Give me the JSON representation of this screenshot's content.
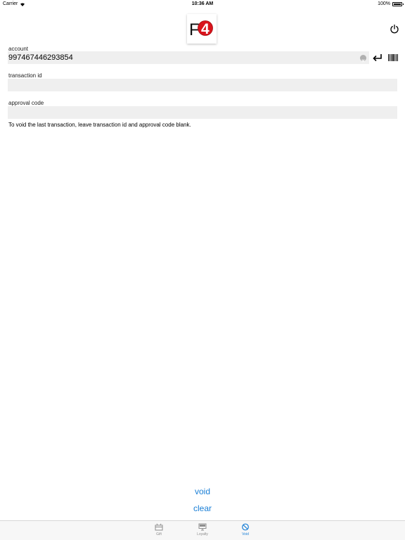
{
  "status_bar": {
    "carrier": "Carrier",
    "time": "10:36 AM",
    "battery": "100%",
    "battery_level": 1.0
  },
  "header": {
    "logo_text": "F4",
    "power_icon": "power-icon"
  },
  "form": {
    "account": {
      "label": "account",
      "value": "997467446293854"
    },
    "transaction_id": {
      "label": "transaction id",
      "value": ""
    },
    "approval_code": {
      "label": "approval code",
      "value": ""
    },
    "hint": "To void the last transaction, leave transaction id and approval code blank."
  },
  "actions": {
    "void_label": "void",
    "clear_label": "clear"
  },
  "tabs": [
    {
      "label": "Gift",
      "icon": "gift-card-icon",
      "active": false
    },
    {
      "label": "Loyalty",
      "icon": "monitor-icon",
      "active": false
    },
    {
      "label": "Void",
      "icon": "no-entry-icon",
      "active": true
    }
  ],
  "colors": {
    "accent": "#1a7fd6",
    "logo_red": "#d9141c",
    "field_bg": "#efefef"
  }
}
